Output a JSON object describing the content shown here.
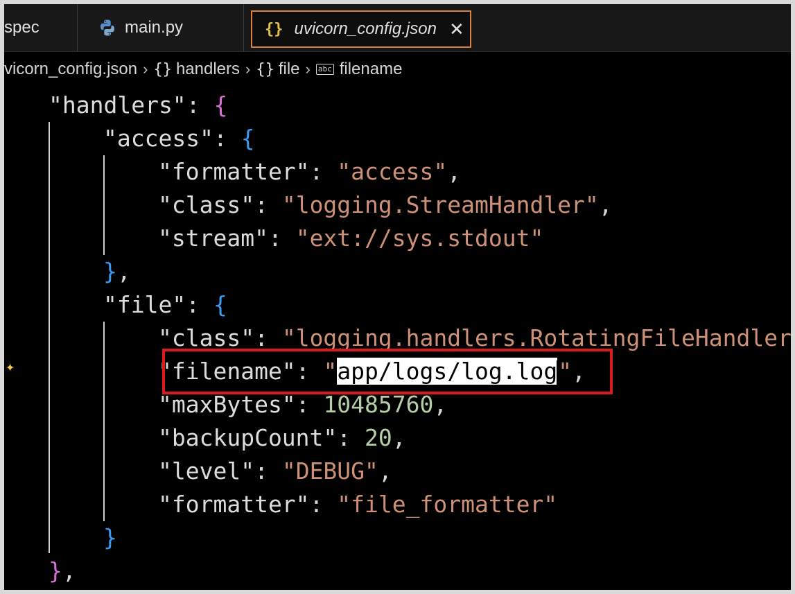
{
  "tabs": [
    {
      "label": "spec"
    },
    {
      "label": "main.py",
      "icon": "python-icon"
    },
    {
      "label": "uvicorn_config.json",
      "icon": "json-braces-icon",
      "active": true
    }
  ],
  "breadcrumb": {
    "file": "vicorn_config.json",
    "items": [
      {
        "icon": "{}",
        "label": "handlers"
      },
      {
        "icon": "{}",
        "label": "file"
      },
      {
        "icon": "abc",
        "label": "filename"
      }
    ]
  },
  "code": {
    "handlers_key": "\"handlers\"",
    "access_key": "\"access\"",
    "access_formatter_key": "\"formatter\"",
    "access_formatter_val": "\"access\"",
    "access_class_key": "\"class\"",
    "access_class_val": "\"logging.StreamHandler\"",
    "access_stream_key": "\"stream\"",
    "access_stream_val": "\"ext://sys.stdout\"",
    "file_key": "\"file\"",
    "file_class_key": "\"class\"",
    "file_class_val": "\"logging.handlers.RotatingFileHandler",
    "filename_key": "\"filename\"",
    "filename_val_selected": "app/logs/log.log",
    "maxbytes_key": "\"maxBytes\"",
    "maxbytes_val": "10485760",
    "backup_key": "\"backupCount\"",
    "backup_val": "20",
    "level_key": "\"level\"",
    "level_val": "\"DEBUG\"",
    "file_formatter_key": "\"formatter\"",
    "file_formatter_val": "\"file_formatter\""
  },
  "colors": {
    "highlight_box": "#d81b1b",
    "active_tab_border": "#d8823c",
    "string": "#ce9178",
    "number": "#b5cea8"
  }
}
